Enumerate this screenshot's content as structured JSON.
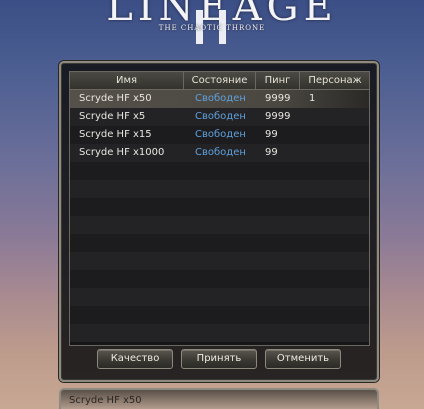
{
  "logo": {
    "title": "LINEAGE",
    "subtitle": "THE CHAOTIC THRONE"
  },
  "table": {
    "columns": [
      "Имя",
      "Состояние",
      "Пинг",
      "Персонаж"
    ],
    "rows": [
      {
        "name": "Scryde HF x50",
        "state": "Свободен",
        "ping": "9999",
        "characters": "1"
      },
      {
        "name": "Scryde HF x5",
        "state": "Свободен",
        "ping": "9999",
        "characters": ""
      },
      {
        "name": "Scryde HF x15",
        "state": "Свободен",
        "ping": "99",
        "characters": ""
      },
      {
        "name": "Scryde HF x1000",
        "state": "Свободен",
        "ping": "99",
        "characters": ""
      }
    ]
  },
  "buttons": {
    "quality": "Качество",
    "accept": "Принять",
    "cancel": "Отменить"
  },
  "bottom_bar": {
    "selected_server": "Scryde HF x50"
  },
  "colors": {
    "status_free": "#5fa0dc",
    "frame": "#8e8a80"
  }
}
